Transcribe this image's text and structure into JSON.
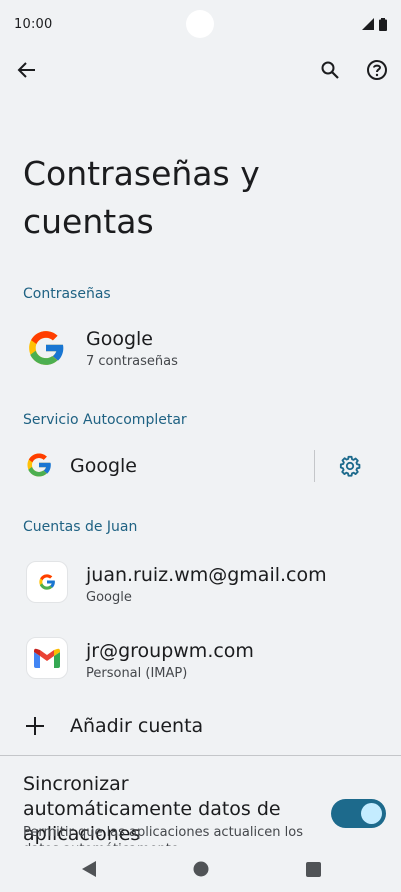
{
  "status_bar": {
    "time": "10:00",
    "icons": [
      "signal-icon",
      "battery-icon"
    ]
  },
  "top_bar": {
    "icons": [
      "back-arrow-icon",
      "search-icon",
      "help-icon"
    ]
  },
  "page": {
    "title": "Contraseñas y cuentas"
  },
  "passwords_section": {
    "header": "Contraseñas",
    "item": {
      "title": "Google",
      "subtitle": "7 contraseñas",
      "icon": "google-logo-icon"
    }
  },
  "autofill_section": {
    "header": "Servicio Autocompletar",
    "item": {
      "title": "Google",
      "icon": "google-logo-icon",
      "settings_icon": "gear-icon"
    }
  },
  "accounts_section": {
    "header": "Cuentas de Juan",
    "accounts": [
      {
        "email": "juan.ruiz.wm@gmail.com",
        "type": "Google",
        "icon": "google-account-icon"
      },
      {
        "email": "jr@groupwm.com",
        "type": "Personal (IMAP)",
        "icon": "gmail-icon"
      }
    ],
    "add_account_label": "Añadir cuenta"
  },
  "sync": {
    "title": "Sincronizar automáticamente datos de aplicaciones",
    "description": "Permitir que las aplicaciones actualicen los datos automáticamente",
    "enabled": true
  },
  "nav_bar": {
    "icons": [
      "nav-back-icon",
      "nav-home-icon",
      "nav-recents-icon"
    ]
  },
  "colors": {
    "background": "#f0f2f4",
    "accent": "#1f6283",
    "toggle_track": "#1d6a8c",
    "toggle_knob": "#c4ecff"
  }
}
